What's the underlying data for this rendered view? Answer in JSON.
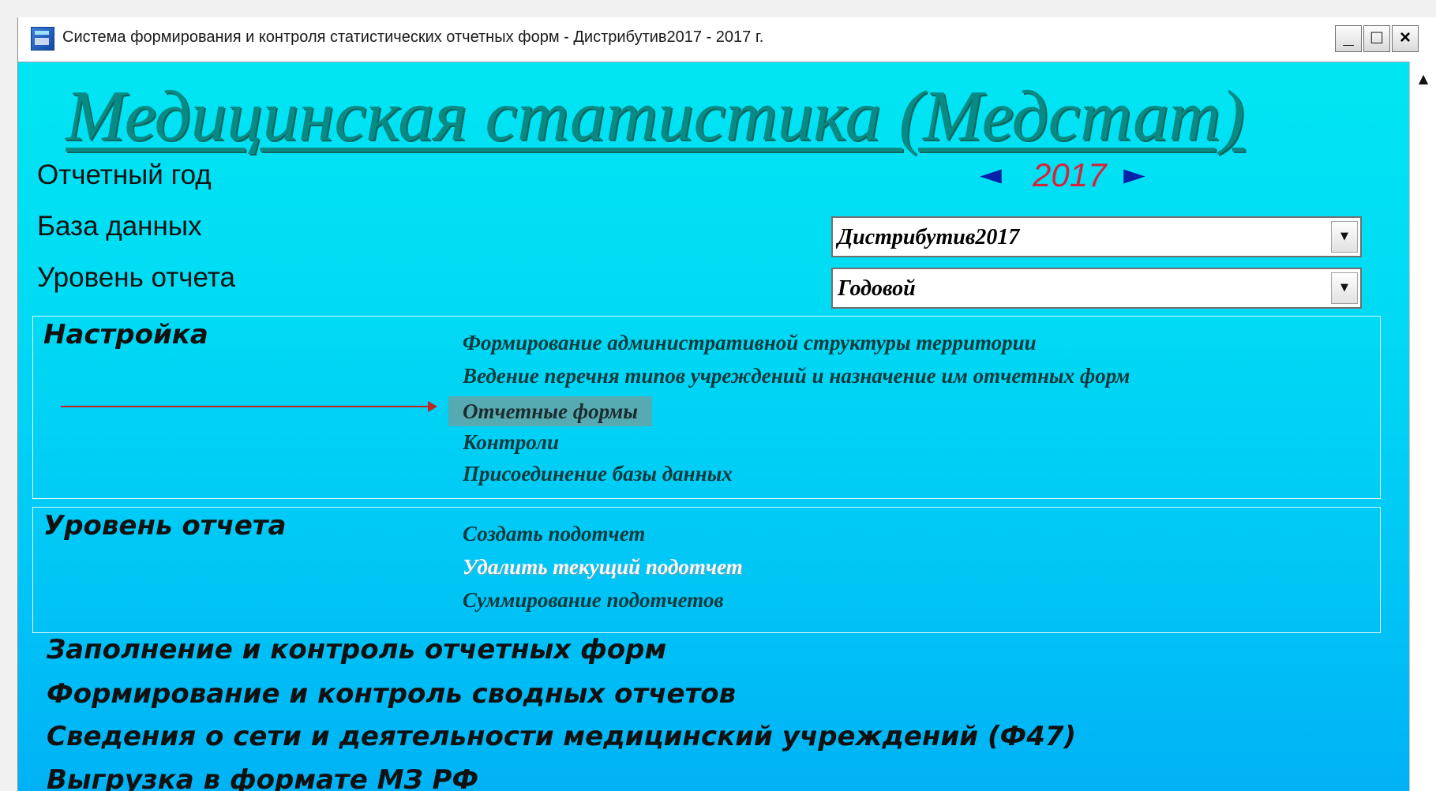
{
  "window": {
    "title": "Система формирования и контроля статистических отчетных форм - Дистрибутив2017 - 2017 г.",
    "controls": {
      "minimize": "_",
      "maximize": "□",
      "close": "×"
    }
  },
  "header": {
    "title": "Медицинская статистика (Медстат)"
  },
  "fields": {
    "year_label": "Отчетный год",
    "year_value": "2017",
    "year_prev_icon": "◄",
    "year_next_icon": "►",
    "database_label": "База данных",
    "database_value": "Дистрибутив2017",
    "level_label": "Уровень отчета",
    "level_value": "Годовой",
    "dropdown_icon": "▼"
  },
  "settings_panel": {
    "heading": "Настройка",
    "items": [
      "Формирование административной структуры территории",
      "Ведение перечня типов учреждений и назначение им  отчетных форм",
      "Отчетные формы",
      "Контроли",
      "Присоединение базы данных"
    ]
  },
  "level_panel": {
    "heading": "Уровень отчета",
    "items": [
      "Создать подотчет",
      "Удалить текущий подотчет",
      "Суммирование подотчетов"
    ]
  },
  "main_actions": [
    "Заполнение и контроль отчетных форм",
    "Формирование и контроль сводных отчетов",
    "Сведения о сети и деятельности медицинский учреждений (Ф47)",
    "Выгрузка в формате МЗ РФ"
  ],
  "scrollbar": {
    "up_icon": "▲"
  },
  "colors": {
    "title": "#0a8a84",
    "year": "#d7233a",
    "nav_arrows": "#0722a8",
    "annotation_arrow": "#c2241e",
    "background_top": "#00e7f3",
    "background_bottom": "#00b2f5"
  }
}
